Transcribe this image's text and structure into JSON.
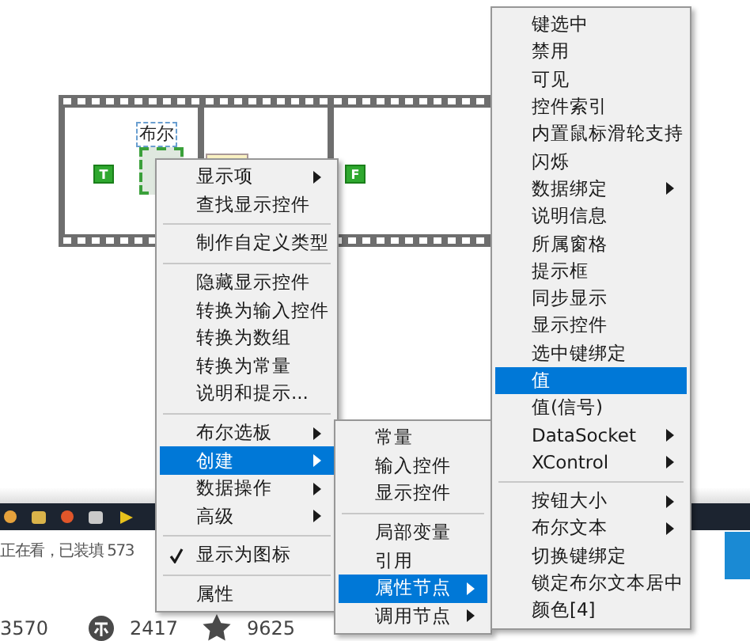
{
  "diagram": {
    "indicator_label": "布尔",
    "true_constant": "T",
    "false_constant": "F"
  },
  "page_behind": {
    "status": "正在看，已装填 573",
    "stats": [
      "3570",
      "2417",
      "9625"
    ]
  },
  "menus": [
    {
      "items": [
        {
          "kind": "item",
          "label": "显示项",
          "submenu": true,
          "selected": false,
          "checked": false
        },
        {
          "kind": "item",
          "label": "查找显示控件",
          "submenu": false,
          "selected": false,
          "checked": false
        },
        {
          "kind": "separator"
        },
        {
          "kind": "item",
          "label": "制作自定义类型",
          "submenu": false,
          "selected": false,
          "checked": false
        },
        {
          "kind": "separator"
        },
        {
          "kind": "item",
          "label": "隐藏显示控件",
          "submenu": false,
          "selected": false,
          "checked": false
        },
        {
          "kind": "item",
          "label": "转换为输入控件",
          "submenu": false,
          "selected": false,
          "checked": false
        },
        {
          "kind": "item",
          "label": "转换为数组",
          "submenu": false,
          "selected": false,
          "checked": false
        },
        {
          "kind": "item",
          "label": "转换为常量",
          "submenu": false,
          "selected": false,
          "checked": false
        },
        {
          "kind": "item",
          "label": "说明和提示...",
          "submenu": false,
          "selected": false,
          "checked": false
        },
        {
          "kind": "separator"
        },
        {
          "kind": "item",
          "label": "布尔选板",
          "submenu": true,
          "selected": false,
          "checked": false
        },
        {
          "kind": "item",
          "label": "创建",
          "submenu": true,
          "selected": true,
          "checked": false
        },
        {
          "kind": "item",
          "label": "数据操作",
          "submenu": true,
          "selected": false,
          "checked": false
        },
        {
          "kind": "item",
          "label": "高级",
          "submenu": true,
          "selected": false,
          "checked": false
        },
        {
          "kind": "separator"
        },
        {
          "kind": "item",
          "label": "显示为图标",
          "submenu": false,
          "selected": false,
          "checked": true
        },
        {
          "kind": "separator"
        },
        {
          "kind": "item",
          "label": "属性",
          "submenu": false,
          "selected": false,
          "checked": false
        }
      ]
    },
    {
      "items": [
        {
          "kind": "item",
          "label": "常量",
          "submenu": false,
          "selected": false
        },
        {
          "kind": "item",
          "label": "输入控件",
          "submenu": false,
          "selected": false
        },
        {
          "kind": "item",
          "label": "显示控件",
          "submenu": false,
          "selected": false
        },
        {
          "kind": "separator"
        },
        {
          "kind": "item",
          "label": "局部变量",
          "submenu": false,
          "selected": false
        },
        {
          "kind": "item",
          "label": "引用",
          "submenu": false,
          "selected": false
        },
        {
          "kind": "item",
          "label": "属性节点",
          "submenu": true,
          "selected": true
        },
        {
          "kind": "item",
          "label": "调用节点",
          "submenu": true,
          "selected": false
        }
      ]
    },
    {
      "items": [
        {
          "kind": "item",
          "label": "键选中",
          "submenu": false,
          "selected": false
        },
        {
          "kind": "item",
          "label": "禁用",
          "submenu": false,
          "selected": false
        },
        {
          "kind": "item",
          "label": "可见",
          "submenu": false,
          "selected": false
        },
        {
          "kind": "item",
          "label": "控件索引",
          "submenu": false,
          "selected": false
        },
        {
          "kind": "item",
          "label": "内置鼠标滑轮支持",
          "submenu": false,
          "selected": false
        },
        {
          "kind": "item",
          "label": "闪烁",
          "submenu": false,
          "selected": false
        },
        {
          "kind": "item",
          "label": "数据绑定",
          "submenu": true,
          "selected": false
        },
        {
          "kind": "item",
          "label": "说明信息",
          "submenu": false,
          "selected": false
        },
        {
          "kind": "item",
          "label": "所属窗格",
          "submenu": false,
          "selected": false
        },
        {
          "kind": "item",
          "label": "提示框",
          "submenu": false,
          "selected": false
        },
        {
          "kind": "item",
          "label": "同步显示",
          "submenu": false,
          "selected": false
        },
        {
          "kind": "item",
          "label": "显示控件",
          "submenu": false,
          "selected": false
        },
        {
          "kind": "item",
          "label": "选中键绑定",
          "submenu": false,
          "selected": false
        },
        {
          "kind": "item",
          "label": "值",
          "submenu": false,
          "selected": true
        },
        {
          "kind": "item",
          "label": "值(信号)",
          "submenu": false,
          "selected": false
        },
        {
          "kind": "item",
          "label": "DataSocket",
          "submenu": true,
          "selected": false
        },
        {
          "kind": "item",
          "label": "XControl",
          "submenu": true,
          "selected": false
        },
        {
          "kind": "separator"
        },
        {
          "kind": "item",
          "label": "按钮大小",
          "submenu": true,
          "selected": false
        },
        {
          "kind": "item",
          "label": "布尔文本",
          "submenu": true,
          "selected": false
        },
        {
          "kind": "item",
          "label": "切换键绑定",
          "submenu": false,
          "selected": false
        },
        {
          "kind": "item",
          "label": "锁定布尔文本居中",
          "submenu": false,
          "selected": false
        },
        {
          "kind": "item",
          "label": "颜色[4]",
          "submenu": false,
          "selected": false
        }
      ]
    }
  ]
}
